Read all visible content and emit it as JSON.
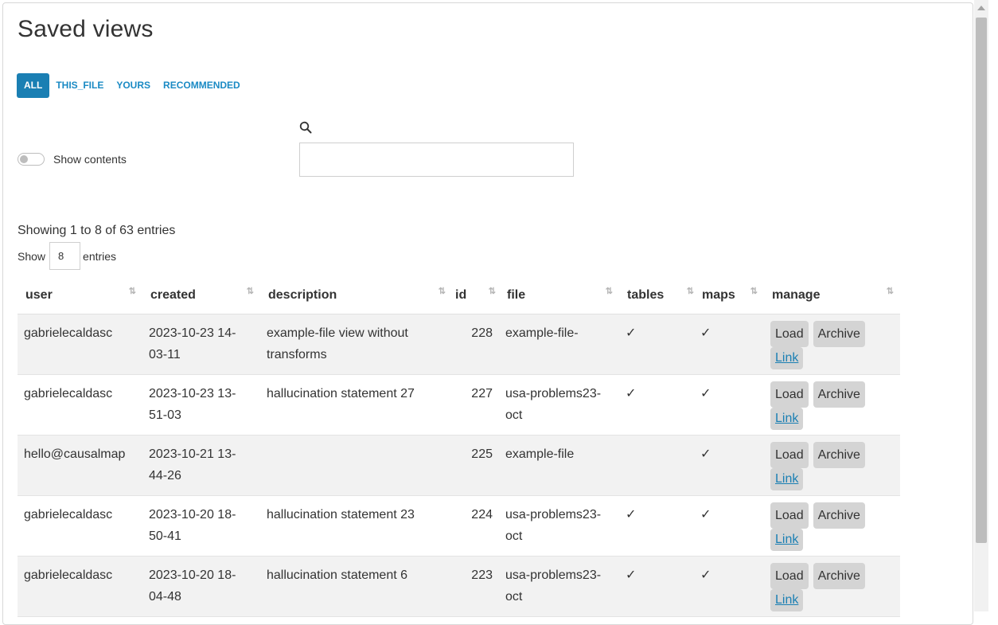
{
  "page": {
    "title": "Saved views"
  },
  "tabs": [
    {
      "label": "ALL",
      "active": true
    },
    {
      "label": "THIS_FILE",
      "active": false
    },
    {
      "label": "YOURS",
      "active": false
    },
    {
      "label": "RECOMMENDED",
      "active": false
    }
  ],
  "toggle": {
    "label": "Show contents",
    "on": false
  },
  "search": {
    "value": "",
    "placeholder": ""
  },
  "info": {
    "showing": "Showing 1 to 8 of 63 entries"
  },
  "length": {
    "prefix": "Show",
    "value": "8",
    "suffix": "entries"
  },
  "table": {
    "headers": {
      "user": "user",
      "created": "created",
      "description": "description",
      "id": "id",
      "file": "file",
      "tables": "tables",
      "maps": "maps",
      "manage": "manage"
    },
    "rows": [
      {
        "user": "gabrielecaldasc",
        "created": "2023-10-23 14-03-11",
        "description": "example-file view without transforms",
        "id": "228",
        "file": "example-file-",
        "tables": "✓",
        "maps": "✓"
      },
      {
        "user": "gabrielecaldasc",
        "created": "2023-10-23 13-51-03",
        "description": "hallucination statement 27",
        "id": "227",
        "file": "usa-problems23-oct",
        "tables": "✓",
        "maps": "✓"
      },
      {
        "user": "hello@causalmap",
        "created": "2023-10-21 13-44-26",
        "description": "",
        "id": "225",
        "file": "example-file",
        "tables": "",
        "maps": "✓"
      },
      {
        "user": "gabrielecaldasc",
        "created": "2023-10-20 18-50-41",
        "description": "hallucination statement 23",
        "id": "224",
        "file": "usa-problems23-oct",
        "tables": "✓",
        "maps": "✓"
      },
      {
        "user": "gabrielecaldasc",
        "created": "2023-10-20 18-04-48",
        "description": "hallucination statement 6",
        "id": "223",
        "file": "usa-problems23-oct",
        "tables": "✓",
        "maps": "✓"
      }
    ],
    "actions": {
      "load": "Load",
      "archive": "Archive",
      "link": "Link"
    }
  }
}
